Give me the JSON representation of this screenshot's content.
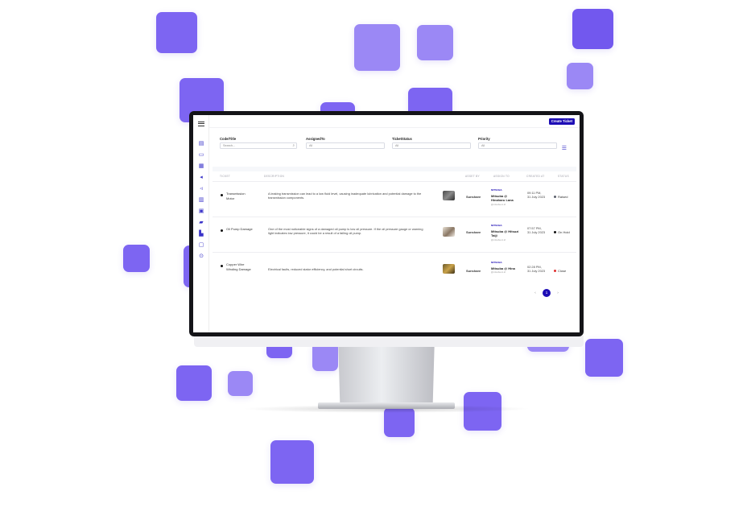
{
  "colors": {
    "accent": "#1d0db5",
    "decor_square": "#7d65f2",
    "status_raised": "#5b5f6b",
    "status_onhold": "#111111",
    "status_close": "#e03131"
  },
  "topbar": {
    "menu_icon": "hamburger-icon",
    "create_button_label": "Create Ticket"
  },
  "sidebar": {
    "icons": [
      "file-icon",
      "chat-icon",
      "document-icon",
      "tag-icon",
      "megaphone-icon",
      "building-icon",
      "calendar-icon",
      "car-icon",
      "truck-icon",
      "lock-icon",
      "settings-icon"
    ]
  },
  "filters": {
    "code_title": {
      "label": "Code/Title",
      "placeholder": "Search..."
    },
    "assigned_to": {
      "label": "AssignedTo",
      "value": "All"
    },
    "ticket_status": {
      "label": "TicketStatus",
      "value": "All"
    },
    "priority": {
      "label": "Priority",
      "value": "All"
    }
  },
  "table": {
    "headers": [
      "TICKET",
      "DESCRIPTION",
      "ASSET BY",
      "ASSIGN TO",
      "CREATED AT",
      "STATUS"
    ],
    "rows": [
      {
        "code": "Transmission Motor",
        "description": "A leaking transmission can lead to a low fluid level, causing inadequate lubrication and potential damage to the transmission components.",
        "asset_by": "Sunshare",
        "brand": "MITSUBA",
        "assignee": "Mitsuba @ Hinaharu Lana",
        "assignee_email": "@mitsuba.co.id",
        "time": "09:11 PM,",
        "date": "31 July 2023",
        "status": "Raised"
      },
      {
        "code": "Oil Pump Damage",
        "description": "One of the most noticeable signs of a damaged oil pump is low oil pressure. If the oil pressure gauge or warning light indicates low pressure, it could be a result of a failing oil pump.",
        "asset_by": "Sunshare",
        "brand": "MITSUBA",
        "assignee": "Mitsuba @ Hitsuzi Taiji",
        "assignee_email": "@mitsuba.co.id",
        "time": "07:57 PM,",
        "date": "31 July 2023",
        "status": "On Hold"
      },
      {
        "code": "Copper Wire Winding Damage",
        "description": "Electrical faults, reduced stator efficiency, and potential short circuits.",
        "asset_by": "Sunshare",
        "brand": "MITSUBA",
        "assignee": "Mitsuba @ Hina",
        "assignee_email": "@mitsuba.co.id",
        "time": "02:28 PM,",
        "date": "31 July 2023",
        "status": "Close"
      }
    ]
  },
  "pagination": {
    "prev": "‹",
    "page": "1",
    "next": "›"
  }
}
